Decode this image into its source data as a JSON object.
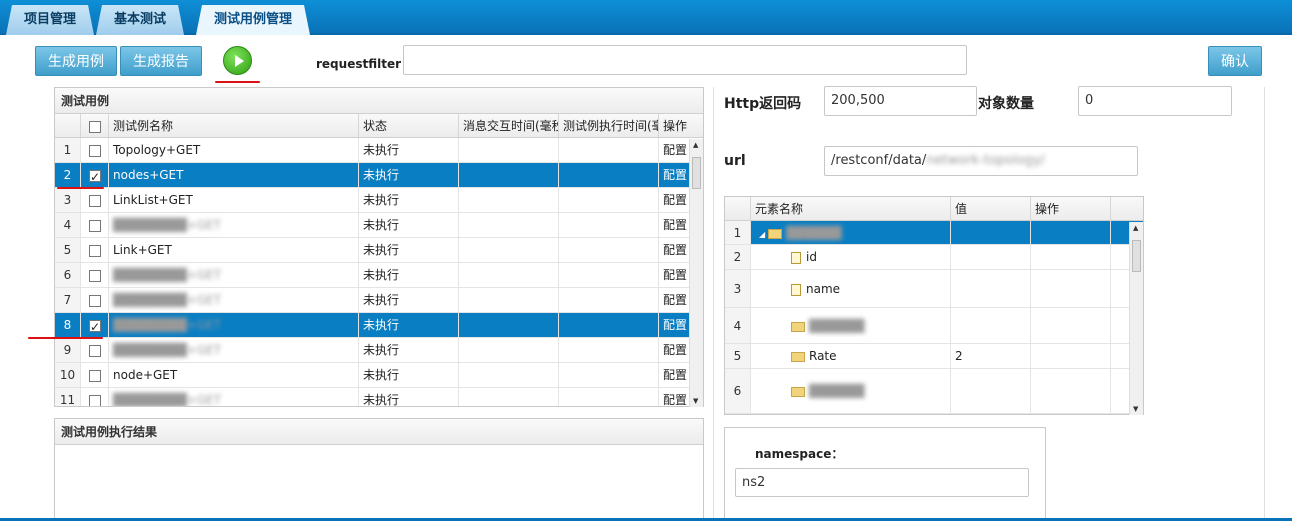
{
  "tabs": [
    {
      "label": "项目管理"
    },
    {
      "label": "基本测试"
    },
    {
      "label": "测试用例管理"
    }
  ],
  "toolbar": {
    "gen_case": "生成用例",
    "gen_report": "生成报告",
    "request_filter_label": "requestfilter：",
    "request_filter_value": "",
    "confirm": "确认"
  },
  "cases_panel": {
    "title": "测试用例",
    "headers": [
      "测试例名称",
      "状态",
      "消息交互时间(毫秒",
      "测试例执行时间(毫",
      "操作"
    ],
    "rows": [
      {
        "num": "1",
        "checked": false,
        "name": "Topology+GET",
        "status": "未执行",
        "op": "配置",
        "sel": false,
        "blur": false
      },
      {
        "num": "2",
        "checked": true,
        "name": "nodes+GET",
        "status": "未执行",
        "op": "配置",
        "sel": true,
        "blur": false
      },
      {
        "num": "3",
        "checked": false,
        "name": "LinkList+GET",
        "status": "未执行",
        "op": "配置",
        "sel": false,
        "blur": false
      },
      {
        "num": "4",
        "checked": false,
        "name": "",
        "status": "未执行",
        "op": "配置",
        "sel": false,
        "blur": true
      },
      {
        "num": "5",
        "checked": false,
        "name": "Link+GET",
        "status": "未执行",
        "op": "配置",
        "sel": false,
        "blur": false
      },
      {
        "num": "6",
        "checked": false,
        "name": "",
        "status": "未执行",
        "op": "配置",
        "sel": false,
        "blur": true
      },
      {
        "num": "7",
        "checked": false,
        "name": "",
        "status": "未执行",
        "op": "配置",
        "sel": false,
        "blur": true
      },
      {
        "num": "8",
        "checked": true,
        "name": "",
        "status": "未执行",
        "op": "配置",
        "sel": true,
        "blur": true
      },
      {
        "num": "9",
        "checked": false,
        "name": "",
        "status": "未执行",
        "op": "配置",
        "sel": false,
        "blur": true
      },
      {
        "num": "10",
        "checked": false,
        "name": "node+GET",
        "status": "未执行",
        "op": "配置",
        "sel": false,
        "blur": false
      },
      {
        "num": "11",
        "checked": false,
        "name": "",
        "status": "未执行",
        "op": "配置",
        "sel": false,
        "blur": true
      }
    ]
  },
  "results_panel": {
    "title": "测试用例执行结果"
  },
  "right": {
    "http_label": "Http返回码",
    "http_value": "200,500",
    "count_label": "对象数量",
    "count_value": "0",
    "url_label": "url",
    "url_value": "/restconf/data/",
    "tree_headers": [
      "元素名称",
      "值",
      "操作"
    ],
    "tree_rows": [
      {
        "num": "1",
        "name": "",
        "value": "",
        "kind": "folder",
        "sel": true,
        "blur": true
      },
      {
        "num": "2",
        "name": "id",
        "value": "",
        "kind": "file",
        "sel": false,
        "blur": false
      },
      {
        "num": "3",
        "name": "name",
        "value": "",
        "kind": "file",
        "sel": false,
        "blur": false
      },
      {
        "num": "4",
        "name": "",
        "value": "",
        "kind": "folder",
        "sel": false,
        "blur": true
      },
      {
        "num": "5",
        "name": "Rate",
        "value": "2",
        "kind": "folder",
        "sel": false,
        "blur": false
      },
      {
        "num": "6",
        "name": "",
        "value": "",
        "kind": "folder",
        "sel": false,
        "blur": true
      }
    ],
    "namespace_label": "namespace：",
    "namespace_value": "ns2"
  },
  "colors": {
    "accent": "#0a7ec2",
    "header_blue": "#0e8fd6",
    "highlight_red": "#d11111",
    "play_green": "#2f9d13"
  }
}
